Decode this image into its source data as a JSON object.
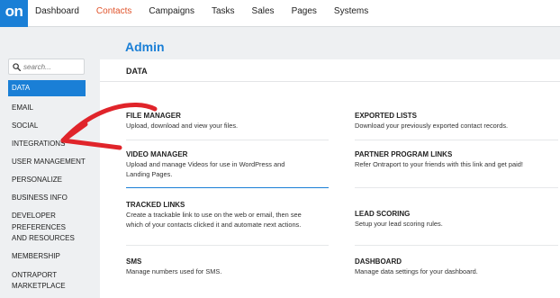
{
  "app": {
    "logo_text": "on"
  },
  "nav": {
    "items": [
      {
        "label": "Dashboard",
        "active": false
      },
      {
        "label": "Contacts",
        "active": true
      },
      {
        "label": "Campaigns",
        "active": false
      },
      {
        "label": "Tasks",
        "active": false
      },
      {
        "label": "Sales",
        "active": false
      },
      {
        "label": "Pages",
        "active": false
      },
      {
        "label": "Systems",
        "active": false
      }
    ]
  },
  "search": {
    "placeholder": "search..."
  },
  "sidebar": {
    "items": [
      {
        "label": "DATA",
        "active": true
      },
      {
        "label": "EMAIL"
      },
      {
        "label": "SOCIAL"
      },
      {
        "label": "INTEGRATIONS"
      },
      {
        "label": "USER MANAGEMENT"
      },
      {
        "label": "PERSONALIZE"
      },
      {
        "label": "BUSINESS INFO"
      },
      {
        "label": "DEVELOPER PREFERENCES AND RESOURCES"
      },
      {
        "label": "MEMBERSHIP"
      },
      {
        "label": "ONTRAPORT MARKETPLACE"
      }
    ]
  },
  "main": {
    "title": "Admin",
    "section_title": "DATA",
    "cards": [
      {
        "title": "FILE MANAGER",
        "desc": "Upload, download and view your files."
      },
      {
        "title": "EXPORTED LISTS",
        "desc": "Download your previously exported contact records."
      },
      {
        "title": "VIDEO MANAGER",
        "desc": "Upload and manage Videos for use in WordPress and Landing Pages."
      },
      {
        "title": "PARTNER PROGRAM LINKS",
        "desc": "Refer Ontraport to your friends with this link and get paid!"
      },
      {
        "title": "TRACKED LINKS",
        "desc": "Create a trackable link to use on the web or email, then see which of your contacts clicked it and automate next actions."
      },
      {
        "title": "LEAD SCORING",
        "desc": "Setup your lead scoring rules."
      },
      {
        "title": "SMS",
        "desc": "Manage numbers used for SMS."
      },
      {
        "title": "DASHBOARD",
        "desc": "Manage data settings for your dashboard."
      }
    ]
  },
  "colors": {
    "accent": "#1a7fd6",
    "nav_active": "#e0532b",
    "annotation_arrow": "#e0242a"
  }
}
